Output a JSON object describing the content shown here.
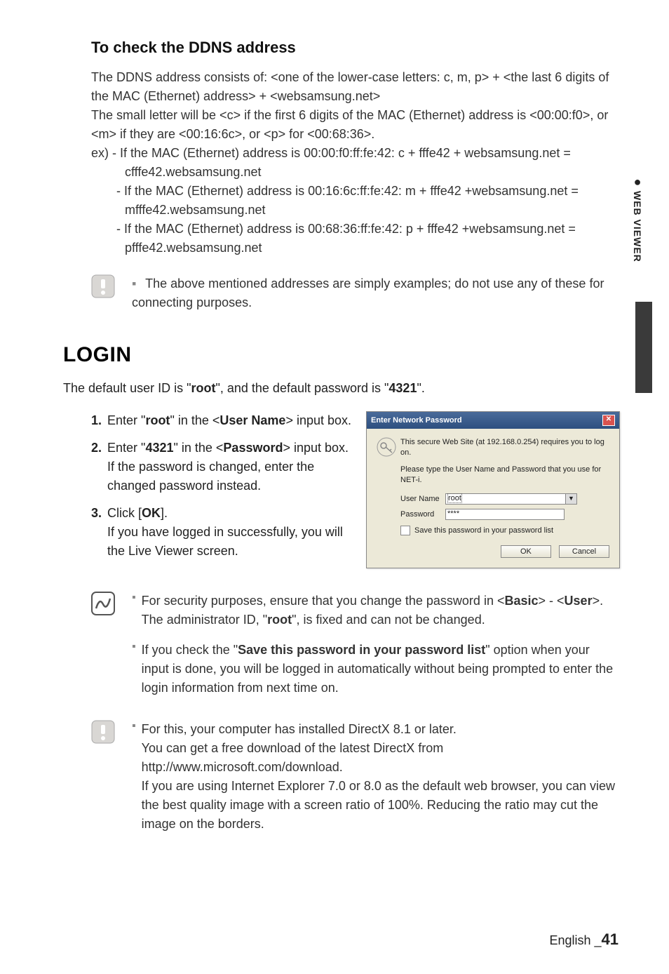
{
  "side_tab": {
    "label": "WEB VIEWER"
  },
  "section1": {
    "heading": "To check the DDNS address",
    "p1": "The DDNS address consists of: <one of the lower-case letters: c, m, p> + <the last 6 digits of the MAC (Ethernet) address> + <websamsung.net>",
    "p2": "The small letter will be <c> if the first 6 digits of the MAC (Ethernet) address is <00:00:f0>, or <m> if they are <00:16:6c>, or <p> for <00:68:36>.",
    "ex_lead": "ex) - If the MAC (Ethernet) address is 00:00:f0:ff:fe:42: c + fffe42 + websamsung.net =",
    "ex1b": "cfffe42.websamsung.net",
    "ex2a": "- If the MAC (Ethernet) address is 00:16:6c:ff:fe:42: m + fffe42 +websamsung.net =",
    "ex2b": "mfffe42.websamsung.net",
    "ex3a": "- If the MAC (Ethernet) address is 00:68:36:ff:fe:42: p + fffe42 +websamsung.net =",
    "ex3b": "pfffe42.websamsung.net",
    "note": "The above mentioned addresses are simply examples; do not use any of these for connecting purposes."
  },
  "login": {
    "heading": "LOGIN",
    "intro_pre": "The default user ID is \"",
    "intro_root": "root",
    "intro_mid": "\", and the default password is \"",
    "intro_pw": "4321",
    "intro_post": "\".",
    "steps": {
      "s1_num": "1.",
      "s1_a": "Enter \"",
      "s1_root": "root",
      "s1_b": "\" in the <",
      "s1_user": "User Name",
      "s1_c": "> input box.",
      "s2_num": "2.",
      "s2_a": "Enter \"",
      "s2_pw": "4321",
      "s2_b": "\" in the <",
      "s2_pass": "Password",
      "s2_c": "> input box.",
      "s2_d": "If the password is changed, enter the changed password instead.",
      "s3_num": "3.",
      "s3_a": "Click [",
      "s3_ok": "OK",
      "s3_b": "].",
      "s3_c": "If you have logged in successfully, you will the Live Viewer screen."
    }
  },
  "dialog": {
    "title": "Enter Network Password",
    "line1": "This secure Web Site (at 192.168.0.254) requires you to log on.",
    "line2": "Please type the User Name and Password that you use for NET-i.",
    "user_label": "User Name",
    "user_value": "root",
    "pass_label": "Password",
    "pass_value": "****",
    "save_label": "Save this password in your password list",
    "ok": "OK",
    "cancel": "Cancel"
  },
  "tips": {
    "t1a": "For security purposes, ensure that you change the password in <",
    "t1_basic": "Basic",
    "t1b": "> - <",
    "t1_user": "User",
    "t1c": ">.",
    "t1d_a": "The administrator ID, \"",
    "t1d_root": "root",
    "t1d_b": "\", is fixed and can not be changed.",
    "t2a": "If you check the \"",
    "t2_savep": "Save this password in your password list",
    "t2b": "\" option when your input is done, you will be logged in automatically without being prompted to enter the login information from next time on.",
    "t3": "For this, your computer has installed DirectX 8.1 or later.",
    "t3b": "You can get a free download of the latest DirectX from http://www.microsoft.com/download.",
    "t3c": "If you are using Internet Explorer 7.0 or 8.0 as the default web browser, you can view the best quality image with a screen ratio of 100%. Reducing the ratio may cut the image on the borders."
  },
  "footer": {
    "lang": "English",
    "sep": "_",
    "page": "41"
  }
}
